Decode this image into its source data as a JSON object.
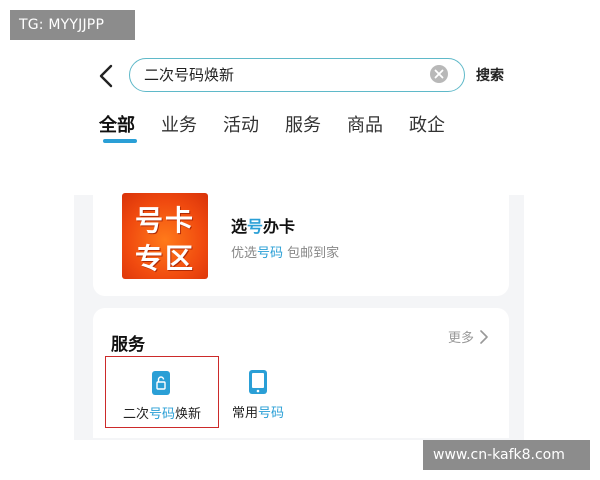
{
  "watermarks": {
    "top_left": "TG: MYYJJPP",
    "bottom_right": "www.cn-kafk8.com"
  },
  "search": {
    "value": "二次号码焕新",
    "button_label": "搜索"
  },
  "tabs": [
    {
      "label": "全部",
      "active": true
    },
    {
      "label": "业务",
      "active": false
    },
    {
      "label": "活动",
      "active": false
    },
    {
      "label": "服务",
      "active": false
    },
    {
      "label": "商品",
      "active": false
    },
    {
      "label": "政企",
      "active": false
    }
  ],
  "promo_card": {
    "image_line1": "号卡",
    "image_line2": "专区",
    "title_pre": "选",
    "title_hl": "号",
    "title_post": "办卡",
    "sub_pre": "优选",
    "sub_hl": "号码",
    "sub_post": " 包邮到家"
  },
  "services": {
    "title": "服务",
    "more_label": "更多",
    "items": [
      {
        "label_pre": "二次",
        "label_hl": "号码",
        "label_post": "焕新",
        "icon": "lock-phone-icon",
        "selected": true
      },
      {
        "label_pre": "常用",
        "label_hl": "号码",
        "label_post": "",
        "icon": "phone-device-icon",
        "selected": false
      }
    ]
  },
  "colors": {
    "accent": "#2a9fd6",
    "search_border": "#5fb9c9",
    "selection": "#cc2a2a",
    "promo_bg": "#f04a0f"
  }
}
